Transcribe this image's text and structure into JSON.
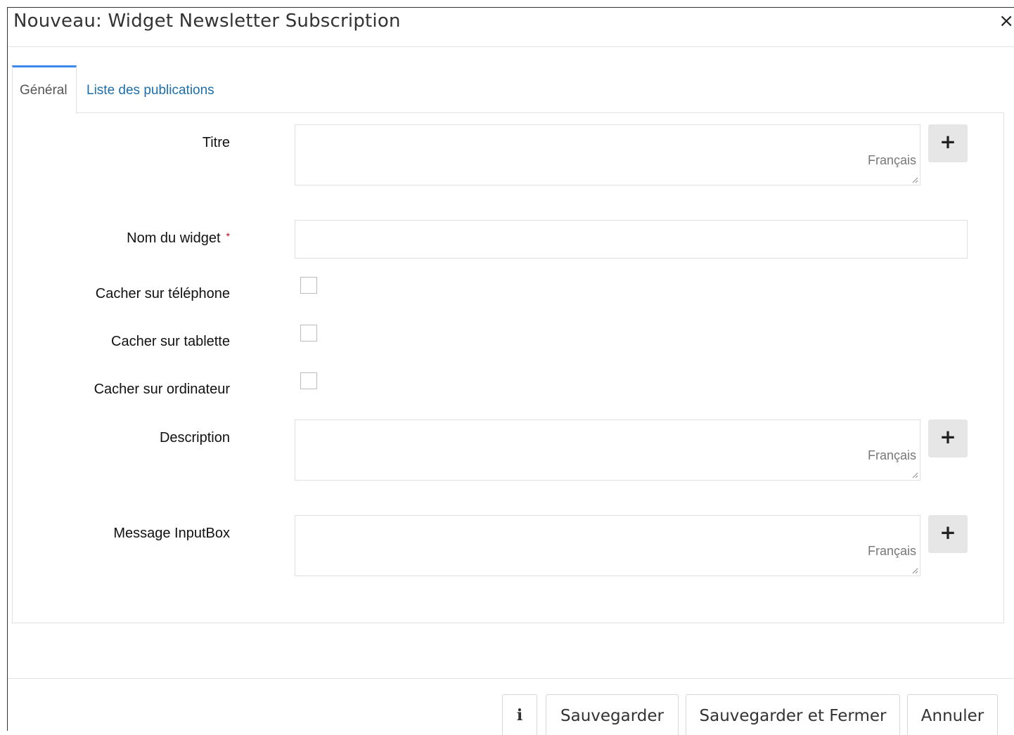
{
  "dialog": {
    "title": "Nouveau: Widget Newsletter Subscription",
    "close_symbol": "×"
  },
  "tabs": [
    {
      "label": "Général",
      "active": true
    },
    {
      "label": "Liste des publications",
      "active": false
    }
  ],
  "form": {
    "title_label": "Titre",
    "title_lang": "Français",
    "widget_name_label": "Nom du widget",
    "required_mark": "*",
    "hide_phone_label": "Cacher sur téléphone",
    "hide_tablet_label": "Cacher sur tablette",
    "hide_desktop_label": "Cacher sur ordinateur",
    "description_label": "Description",
    "description_lang": "Français",
    "message_label": "Message InputBox",
    "message_lang": "Français",
    "add_symbol": "+",
    "hide_phone_checked": false,
    "hide_tablet_checked": false,
    "hide_desktop_checked": false
  },
  "footer": {
    "info_symbol": "i",
    "save_label": "Sauvegarder",
    "save_close_label": "Sauvegarder et Fermer",
    "cancel_label": "Annuler"
  },
  "colors": {
    "accent": "#3b89ec",
    "link": "#1e6ea8",
    "required": "#d0021b"
  }
}
